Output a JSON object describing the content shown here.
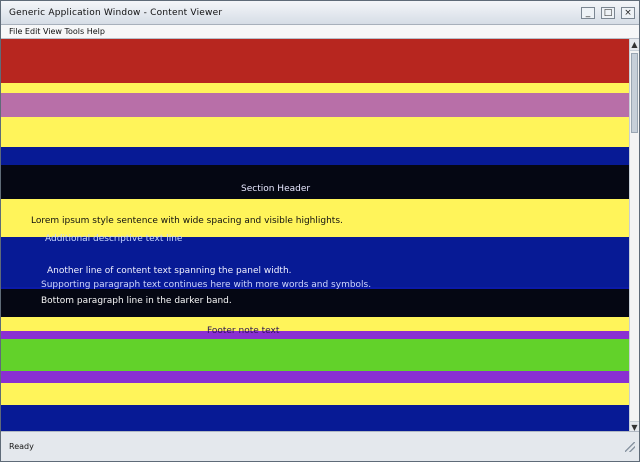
{
  "window": {
    "title": "Generic Application Window - Content Viewer",
    "subbar": "File Edit View Tools Help",
    "controls": {
      "minimize": "_",
      "maximize": "□",
      "close": "×"
    }
  },
  "content": {
    "line1": "Section Header",
    "line2": "Lorem ipsum style sentence with wide spacing and visible highlights.",
    "line3": "Additional descriptive text line",
    "line4": "Another line of content text spanning the panel width.",
    "line5": "Supporting paragraph text continues here with more words and symbols.",
    "line6": "Bottom paragraph line in the darker band.",
    "line7": "Footer note text"
  },
  "status": {
    "text": "Ready"
  },
  "colors": {
    "red": "#b7261f",
    "yellow": "#fff45a",
    "pink": "#b86fa8",
    "blue": "#071a95",
    "black": "#050713",
    "green": "#62d22a",
    "purple": "#8a2fd2"
  },
  "icons": {
    "scroll_up": "scroll-up-icon",
    "scroll_down": "scroll-down-icon",
    "resize_grip": "resize-grip-icon"
  }
}
